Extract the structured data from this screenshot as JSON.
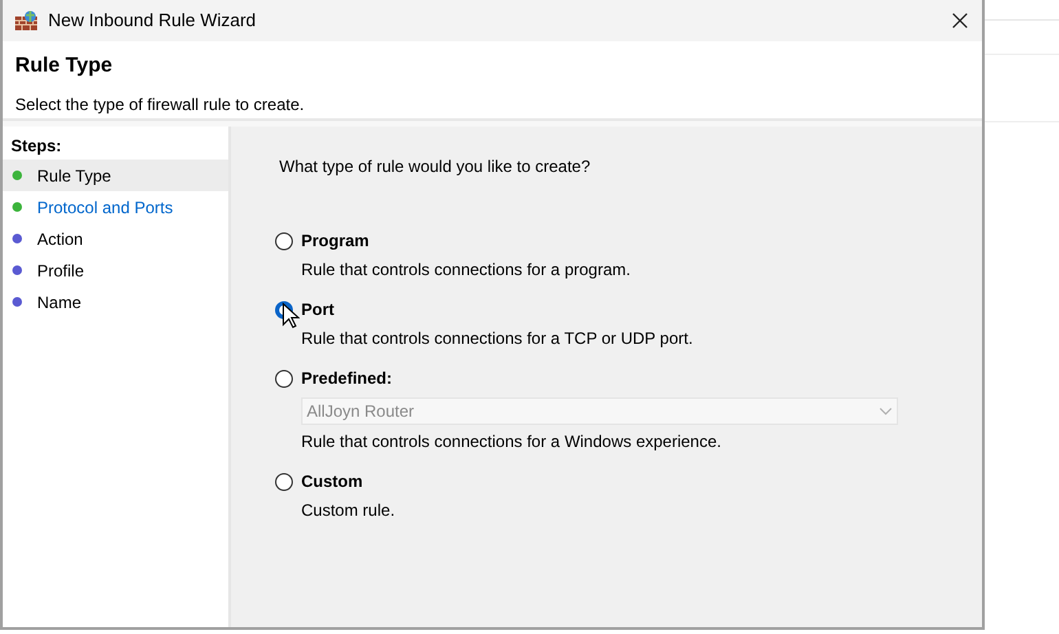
{
  "window": {
    "title": "New Inbound Rule Wizard"
  },
  "header": {
    "title": "Rule Type",
    "subtitle": "Select the type of firewall rule to create."
  },
  "steps": {
    "heading": "Steps:",
    "items": [
      {
        "label": "Rule Type",
        "selected": true,
        "highlighted": false,
        "color": "#3cb43c"
      },
      {
        "label": "Protocol and Ports",
        "selected": false,
        "highlighted": true,
        "color": "#3cb43c"
      },
      {
        "label": "Action",
        "selected": false,
        "highlighted": false,
        "color": "#5a5ad2"
      },
      {
        "label": "Profile",
        "selected": false,
        "highlighted": false,
        "color": "#5a5ad2"
      },
      {
        "label": "Name",
        "selected": false,
        "highlighted": false,
        "color": "#5a5ad2"
      }
    ]
  },
  "question": "What type of rule would you like to create?",
  "options": [
    {
      "title": "Program",
      "description": "Rule that controls connections for a program.",
      "selected": false
    },
    {
      "title": "Port",
      "description": "Rule that controls connections for a TCP or UDP port.",
      "selected": true
    },
    {
      "title": "Predefined:",
      "description": "Rule that controls connections for a Windows experience.",
      "selected": false,
      "dropdown": {
        "value": "AllJoyn Router",
        "disabled": true
      }
    },
    {
      "title": "Custom",
      "description": "Custom rule.",
      "selected": false
    }
  ]
}
